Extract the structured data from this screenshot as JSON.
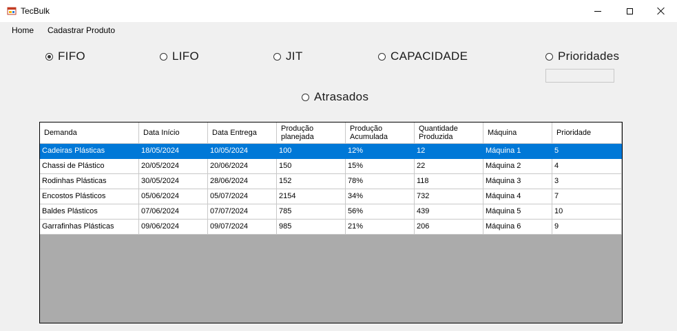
{
  "window": {
    "title": "TecBulk"
  },
  "menu": {
    "items": [
      "Home",
      "Cadastrar Produto"
    ]
  },
  "radios": [
    {
      "label": "FIFO",
      "checked": true
    },
    {
      "label": "LIFO",
      "checked": false
    },
    {
      "label": "JIT",
      "checked": false
    },
    {
      "label": "CAPACIDADE",
      "checked": false
    },
    {
      "label": "Prioridades",
      "checked": false
    },
    {
      "label": "Atrasados",
      "checked": false
    }
  ],
  "prioridades_input": {
    "value": ""
  },
  "table": {
    "columns": [
      "Demanda",
      "Data Início",
      "Data Entrega",
      "Produção\nplanejada",
      "Produção\nAcumulada",
      "Quantidade\nProduzida",
      "Máquina",
      "Prioridade"
    ],
    "selected_row": 0,
    "rows": [
      [
        "Cadeiras Plásticas",
        "18/05/2024",
        "10/05/2024",
        "100",
        "12%",
        "12",
        "Máquina 1",
        "5"
      ],
      [
        "Chassi de Plástico",
        "20/05/2024",
        "20/06/2024",
        "150",
        "15%",
        "22",
        "Máquina 2",
        "4"
      ],
      [
        "Rodinhas Plásticas",
        "30/05/2024",
        "28/06/2024",
        "152",
        "78%",
        "118",
        "Máquina 3",
        "3"
      ],
      [
        "Encostos Plásticos",
        "05/06/2024",
        "05/07/2024",
        "2154",
        "34%",
        "732",
        "Máquina 4",
        "7"
      ],
      [
        "Baldes Plásticos",
        "07/06/2024",
        "07/07/2024",
        "785",
        "56%",
        "439",
        "Máquina 5",
        "10"
      ],
      [
        "Garrafinhas Plásticas",
        "09/06/2024",
        "09/07/2024",
        "985",
        "21%",
        "206",
        "Máquina 6",
        "9"
      ]
    ]
  },
  "colors": {
    "selection": "#0078d7",
    "grid_background": "#ababab"
  },
  "icons": {
    "app": "app-window-icon",
    "minimize": "minimize-icon",
    "maximize": "maximize-icon",
    "close": "close-icon",
    "radio": "radio-icon"
  }
}
